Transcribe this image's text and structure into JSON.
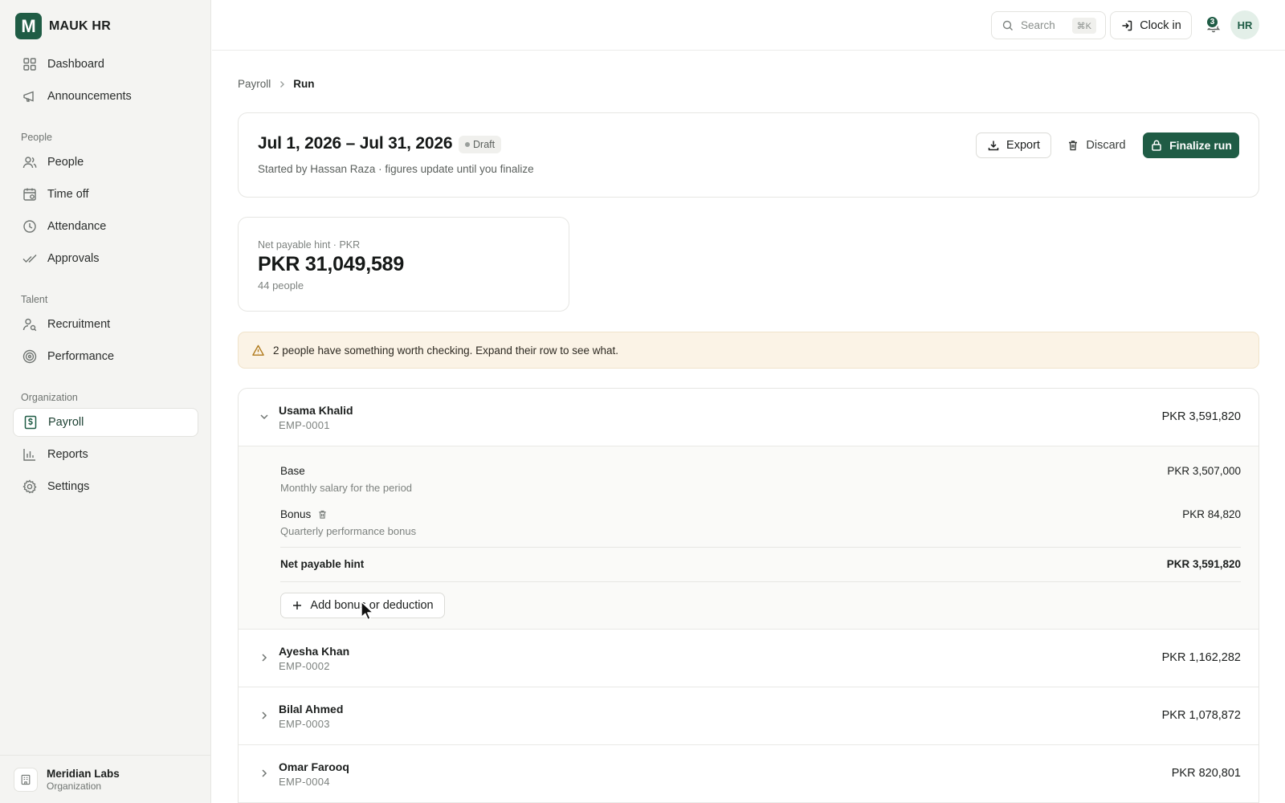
{
  "brand": {
    "logo_letter": "M",
    "name": "MAUK HR"
  },
  "sidebar": {
    "top_items": [
      {
        "label": "Dashboard",
        "icon": "dashboard-icon"
      },
      {
        "label": "Announcements",
        "icon": "megaphone-icon"
      }
    ],
    "sections": [
      {
        "title": "People",
        "items": [
          {
            "label": "People",
            "icon": "users-icon"
          },
          {
            "label": "Time off",
            "icon": "calendar-icon"
          },
          {
            "label": "Attendance",
            "icon": "clock-icon"
          },
          {
            "label": "Approvals",
            "icon": "check-double-icon"
          }
        ]
      },
      {
        "title": "Talent",
        "items": [
          {
            "label": "Recruitment",
            "icon": "user-search-icon"
          },
          {
            "label": "Performance",
            "icon": "target-icon"
          }
        ]
      },
      {
        "title": "Organization",
        "items": [
          {
            "label": "Payroll",
            "icon": "dollar-file-icon",
            "active": true
          },
          {
            "label": "Reports",
            "icon": "bar-chart-icon"
          },
          {
            "label": "Settings",
            "icon": "gear-icon"
          }
        ]
      }
    ],
    "org": {
      "name": "Meridian Labs",
      "role": "Organization"
    }
  },
  "topbar": {
    "search_placeholder": "Search",
    "search_shortcut": "⌘K",
    "clock_in_label": "Clock in",
    "notification_count": "3",
    "avatar_initials": "HR"
  },
  "breadcrumb": {
    "parent": "Payroll",
    "current": "Run"
  },
  "run": {
    "title": "Jul 1, 2026 – Jul 31, 2026",
    "status": "Draft",
    "subtitle": "Started by Hassan Raza · figures update until you finalize",
    "export_label": "Export",
    "discard_label": "Discard",
    "finalize_label": "Finalize run"
  },
  "summary": {
    "label": "Net payable hint · PKR",
    "value": "PKR 31,049,589",
    "count": "44 people"
  },
  "warning": {
    "text": "2 people have something worth checking. Expand their row to see what."
  },
  "employees": [
    {
      "name": "Usama Khalid",
      "id": "EMP-0001",
      "amount": "PKR 3,591,820",
      "expanded": true,
      "lines": [
        {
          "title": "Base",
          "desc": "Monthly salary for the period",
          "amount": "PKR 3,507,000"
        },
        {
          "title": "Bonus",
          "desc": "Quarterly performance bonus",
          "amount": "PKR 84,820"
        }
      ],
      "net_label": "Net payable hint",
      "net_amount": "PKR 3,591,820",
      "add_label": "Add bonus or deduction"
    },
    {
      "name": "Ayesha Khan",
      "id": "EMP-0002",
      "amount": "PKR 1,162,282"
    },
    {
      "name": "Bilal Ahmed",
      "id": "EMP-0003",
      "amount": "PKR 1,078,872"
    },
    {
      "name": "Omar Farooq",
      "id": "EMP-0004",
      "amount": "PKR 820,801"
    }
  ],
  "colors": {
    "brand": "#1f5c45",
    "warning_bg": "#fbf3e6",
    "sidebar_bg": "#f4f4f2"
  }
}
